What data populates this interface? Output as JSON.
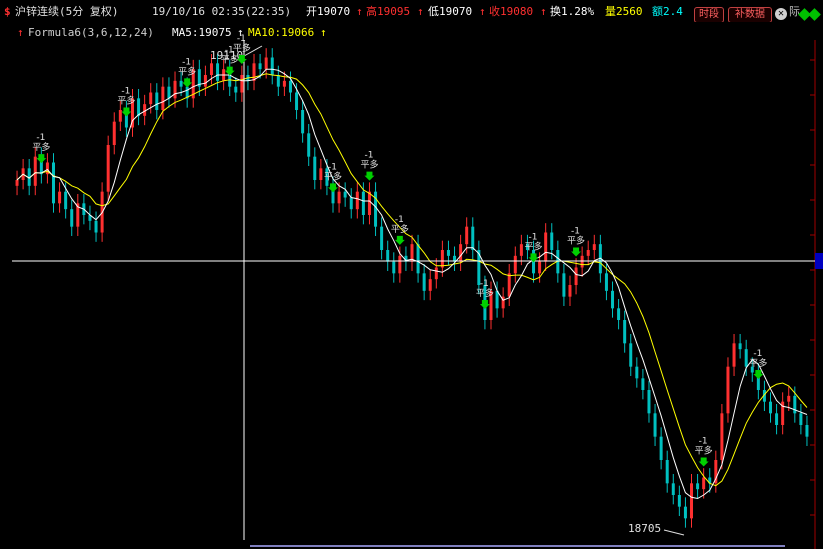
{
  "header": {
    "symbol_icon": "$",
    "title": "沪锌连续(5分 复权)",
    "datetime": "19/10/16 02:35(22:35)",
    "open_label": "开19070",
    "high_label": "高19095",
    "low_label": "低19070",
    "close_label": "收19080",
    "turnover_label": "换1.28%",
    "volume_label": "量2560",
    "amount_label": "额2.4",
    "buttons": [
      "时段",
      "补数据"
    ],
    "fragment_label": "际",
    "colors": {
      "open": "#ffffff",
      "high": "#ff3030",
      "low": "#ffffff",
      "close": "#ff3030",
      "turnover": "#ffffff",
      "volume": "#ffff00",
      "amount": "#00ffff"
    }
  },
  "indicator": {
    "arrow_icon": "up-arrow-icon",
    "formula_label": "Formula6(3,6,12,24)",
    "ma5_label": "MA5:19075",
    "ma10_label": "MA10:19066",
    "ma5_color": "#ffffff",
    "ma10_color": "#ffff00"
  },
  "crosshair": {
    "price_label": "19110"
  },
  "annotations": {
    "high_label": "19110",
    "low_label": "18705",
    "signal_value": "-1",
    "signal_text": "平多"
  },
  "chart_data": {
    "type": "candlestick",
    "ma5_color": "#ffffff",
    "ma10_color": "#ffff00",
    "up_color": "#ff3030",
    "down_color": "#00c0c0",
    "marked_high": 19110,
    "marked_low": 18705,
    "signals": [
      "平多",
      "平多",
      "平多",
      "平多",
      "平多",
      "平多",
      "平多",
      "平多",
      "平多",
      "平多",
      "平多",
      "平多",
      "平多"
    ],
    "ylim": [
      18700,
      19120
    ],
    "closes": [
      19000,
      19010,
      18995,
      19020,
      19005,
      19015,
      18980,
      18990,
      18975,
      18960,
      18980,
      18970,
      18965,
      18955,
      18990,
      19030,
      19050,
      19060,
      19045,
      19070,
      19055,
      19065,
      19075,
      19060,
      19080,
      19070,
      19085,
      19080,
      19070,
      19095,
      19080,
      19090,
      19100,
      19085,
      19095,
      19080,
      19075,
      19090,
      19085,
      19100,
      19095,
      19105,
      19090,
      19080,
      19085,
      19075,
      19060,
      19040,
      19020,
      19000,
      19010,
      18995,
      18980,
      18990,
      18985,
      18975,
      18990,
      18970,
      18990,
      18960,
      18940,
      18930,
      18920,
      18935,
      18930,
      18945,
      18920,
      18905,
      18915,
      18925,
      18940,
      18935,
      18930,
      18945,
      18960,
      18940,
      18910,
      18880,
      18905,
      18890,
      18900,
      18920,
      18935,
      18945,
      18940,
      18920,
      18930,
      18955,
      18940,
      18920,
      18900,
      18910,
      18925,
      18935,
      18940,
      18945,
      18920,
      18905,
      18890,
      18880,
      18860,
      18840,
      18830,
      18820,
      18800,
      18780,
      18760,
      18740,
      18730,
      18720,
      18710,
      18740,
      18735,
      18745,
      18740,
      18760,
      18800,
      18840,
      18860,
      18855,
      18840,
      18835,
      18820,
      18810,
      18800,
      18790,
      18810,
      18815,
      18800,
      18790,
      18780
    ]
  }
}
